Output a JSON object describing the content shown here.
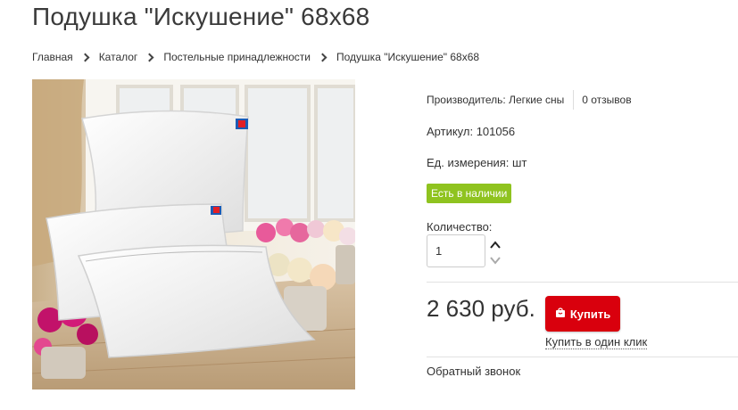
{
  "product": {
    "title": "Подушка \"Искушение\" 68х68"
  },
  "breadcrumb": [
    {
      "label": "Главная"
    },
    {
      "label": "Каталог"
    },
    {
      "label": "Постельные принадлежности"
    },
    {
      "label": "Подушка \"Искушение\" 68х68"
    }
  ],
  "info": {
    "manufacturer": "Производитель: Легкие сны",
    "reviews": "0 отзывов",
    "sku": "Артикул: 101056",
    "unit": "Ед. измерения: шт",
    "stock": "Есть в наличии",
    "quantity_label": "Количество:",
    "quantity_value": "1"
  },
  "purchase": {
    "price": "2 630 руб.",
    "buy_label": "Купить",
    "one_click_label": "Купить в один клик",
    "callback_label": "Обратный звонок"
  },
  "colors": {
    "buy_button": "#d9000d",
    "stock_badge": "#8fc31f"
  },
  "icons": {
    "breadcrumb_separator": "chevron-right-icon",
    "quantity_up": "chevron-up-icon",
    "quantity_down": "chevron-down-icon",
    "buy": "shopping-bag-icon"
  }
}
